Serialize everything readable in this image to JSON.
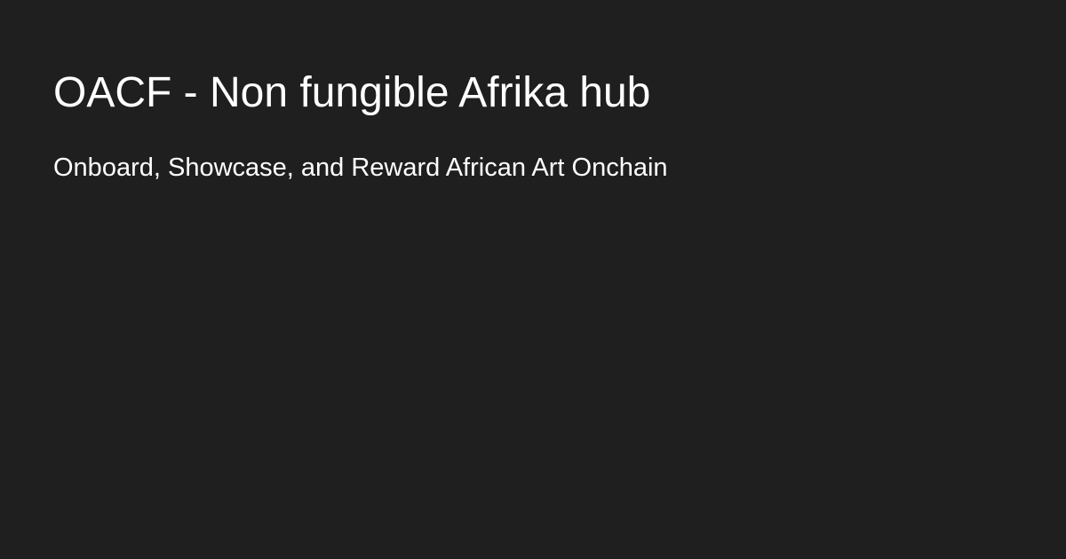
{
  "card": {
    "title": "OACF - Non fungible Afrika hub",
    "subtitle": "Onboard, Showcase, and Reward African Art Onchain"
  },
  "colors": {
    "background": "#1f1f1f",
    "text": "#ffffff"
  }
}
